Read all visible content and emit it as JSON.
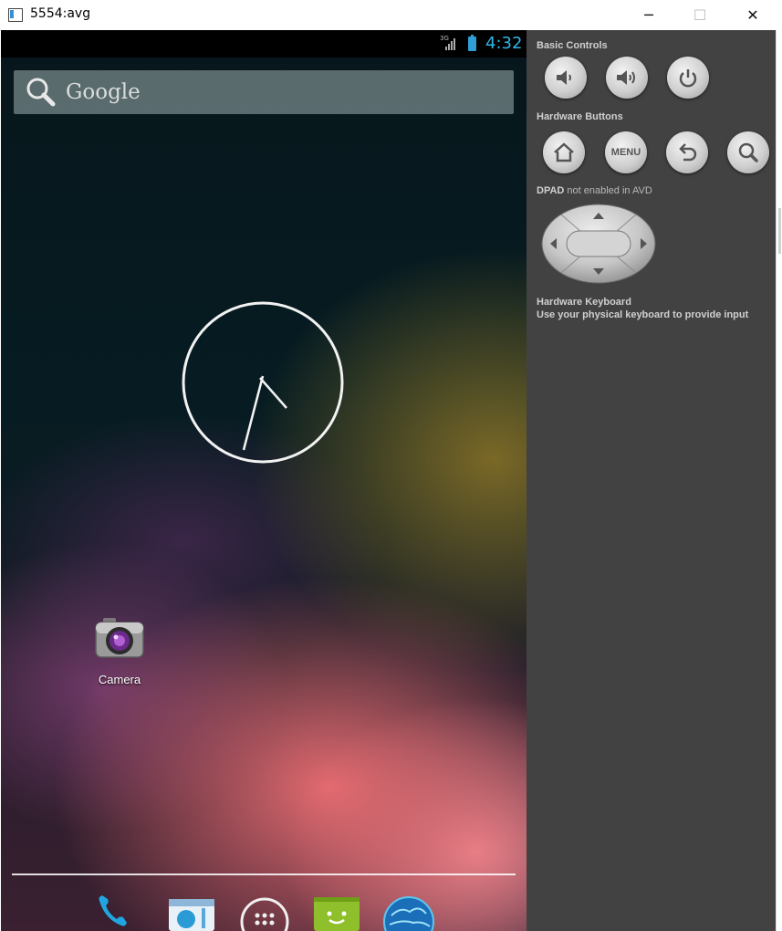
{
  "window": {
    "title": "5554:avg",
    "controls": {
      "minimize": "─",
      "maximize": "☐",
      "close": "✕"
    }
  },
  "statusbar": {
    "network": "3G",
    "time": "4:32"
  },
  "homescreen": {
    "search_label": "Google",
    "apps": [
      {
        "label": "Camera",
        "icon": "camera-icon"
      }
    ],
    "dock": [
      "phone-icon",
      "people-icon",
      "all-apps-icon",
      "play-store-icon",
      "browser-icon"
    ]
  },
  "panel": {
    "basic_controls_label": "Basic Controls",
    "basic_controls": [
      "volume-down-icon",
      "volume-up-icon",
      "power-icon"
    ],
    "hardware_buttons_label": "Hardware Buttons",
    "hardware_buttons": [
      "home-icon",
      "MENU",
      "back-icon",
      "search-icon"
    ],
    "dpad_label": "DPAD",
    "dpad_note": "not enabled in AVD",
    "keyboard_label": "Hardware Keyboard",
    "keyboard_note": "Use your physical keyboard to provide input"
  },
  "colors": {
    "accent": "#2fb6e8",
    "panel_bg": "#424242",
    "status_bar": "#000000"
  }
}
